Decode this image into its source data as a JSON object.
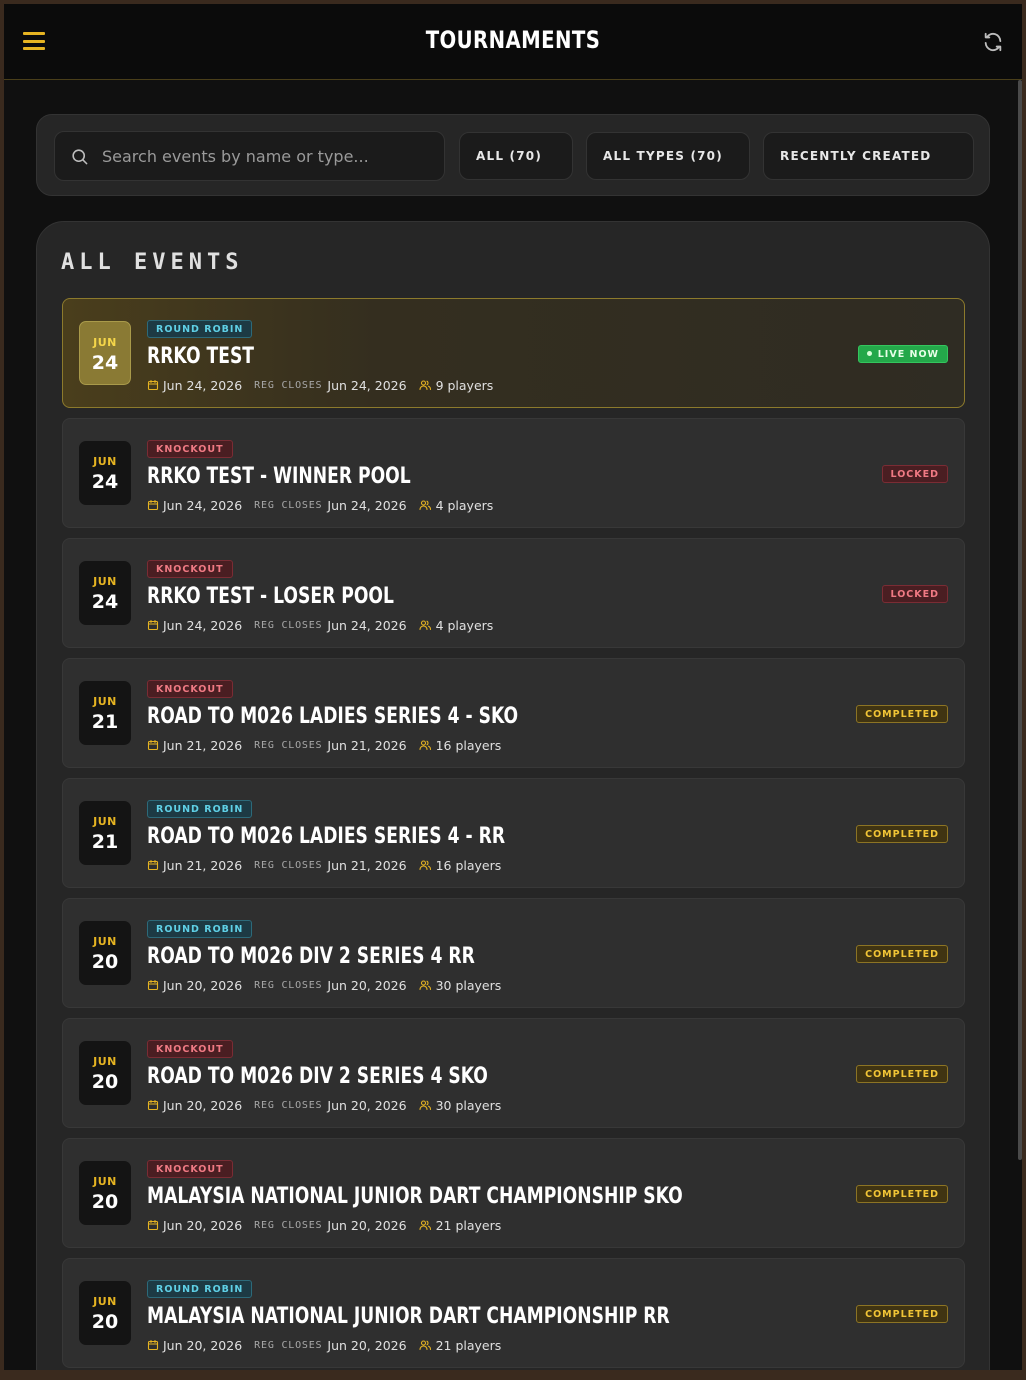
{
  "header": {
    "title": "TOURNAMENTS",
    "menu_icon": "hamburger-menu-icon",
    "refresh_icon": "refresh-icon"
  },
  "filters": {
    "search_placeholder": "Search events by name or type...",
    "status_filter": "ALL (70)",
    "type_filter": "ALL TYPES (70)",
    "sort": "RECENTLY CREATED"
  },
  "events_section": {
    "title": "ALL EVENTS",
    "reg_label": "REG CLOSES",
    "events": [
      {
        "month": "JUN",
        "day": "24",
        "type": "ROUND ROBIN",
        "type_kind": "rr",
        "name": "RRKO TEST",
        "date": "Jun 24, 2026",
        "reg_closes": "Jun 24, 2026",
        "players": "9 players",
        "status": "LIVE NOW",
        "status_kind": "live"
      },
      {
        "month": "JUN",
        "day": "24",
        "type": "KNOCKOUT",
        "type_kind": "ko",
        "name": "RRKO TEST - WINNER POOL",
        "date": "Jun 24, 2026",
        "reg_closes": "Jun 24, 2026",
        "players": "4 players",
        "status": "LOCKED",
        "status_kind": "locked"
      },
      {
        "month": "JUN",
        "day": "24",
        "type": "KNOCKOUT",
        "type_kind": "ko",
        "name": "RRKO TEST - LOSER POOL",
        "date": "Jun 24, 2026",
        "reg_closes": "Jun 24, 2026",
        "players": "4 players",
        "status": "LOCKED",
        "status_kind": "locked"
      },
      {
        "month": "JUN",
        "day": "21",
        "type": "KNOCKOUT",
        "type_kind": "ko",
        "name": "ROAD TO M026 LADIES SERIES 4 - SKO",
        "date": "Jun 21, 2026",
        "reg_closes": "Jun 21, 2026",
        "players": "16 players",
        "status": "COMPLETED",
        "status_kind": "completed"
      },
      {
        "month": "JUN",
        "day": "21",
        "type": "ROUND ROBIN",
        "type_kind": "rr",
        "name": "ROAD TO M026 LADIES SERIES 4 - RR",
        "date": "Jun 21, 2026",
        "reg_closes": "Jun 21, 2026",
        "players": "16 players",
        "status": "COMPLETED",
        "status_kind": "completed"
      },
      {
        "month": "JUN",
        "day": "20",
        "type": "ROUND ROBIN",
        "type_kind": "rr",
        "name": "ROAD TO M026 DIV 2 SERIES 4 RR",
        "date": "Jun 20, 2026",
        "reg_closes": "Jun 20, 2026",
        "players": "30 players",
        "status": "COMPLETED",
        "status_kind": "completed"
      },
      {
        "month": "JUN",
        "day": "20",
        "type": "KNOCKOUT",
        "type_kind": "ko",
        "name": "ROAD TO M026 DIV 2 SERIES 4 SKO",
        "date": "Jun 20, 2026",
        "reg_closes": "Jun 20, 2026",
        "players": "30 players",
        "status": "COMPLETED",
        "status_kind": "completed"
      },
      {
        "month": "JUN",
        "day": "20",
        "type": "KNOCKOUT",
        "type_kind": "ko",
        "name": "MALAYSIA NATIONAL JUNIOR DART CHAMPIONSHIP SKO",
        "date": "Jun 20, 2026",
        "reg_closes": "Jun 20, 2026",
        "players": "21 players",
        "status": "COMPLETED",
        "status_kind": "completed"
      },
      {
        "month": "JUN",
        "day": "20",
        "type": "ROUND ROBIN",
        "type_kind": "rr",
        "name": "MALAYSIA NATIONAL JUNIOR DART CHAMPIONSHIP RR",
        "date": "Jun 20, 2026",
        "reg_closes": "Jun 20, 2026",
        "players": "21 players",
        "status": "COMPLETED",
        "status_kind": "completed"
      }
    ]
  }
}
